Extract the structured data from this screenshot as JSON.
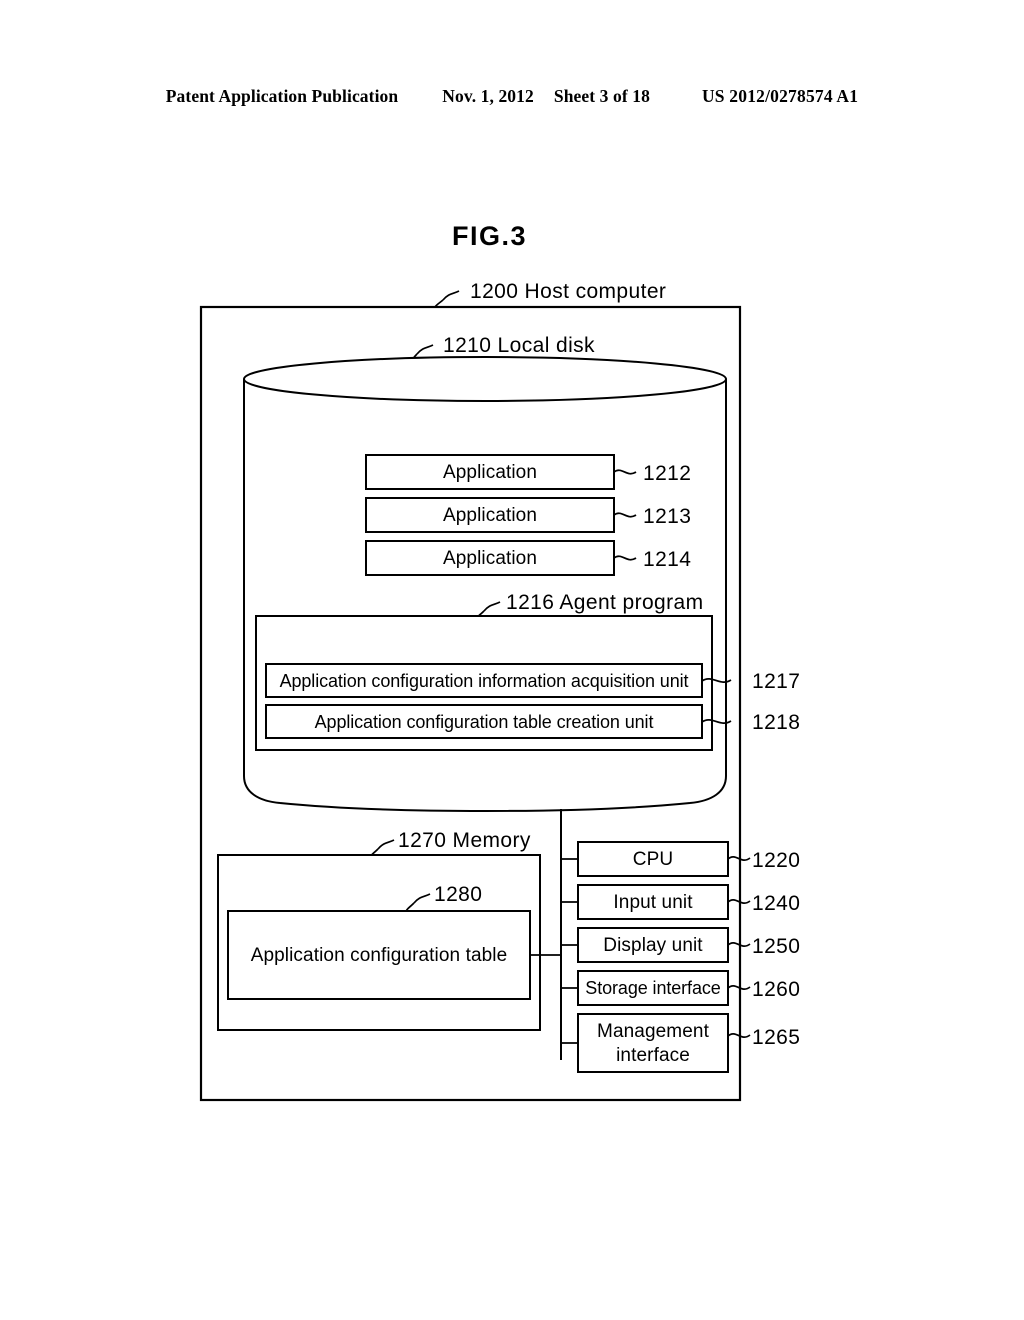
{
  "header": {
    "publication": "Patent Application Publication",
    "date": "Nov. 1, 2012",
    "sheet": "Sheet 3 of 18",
    "patent_number": "US 2012/0278574 A1"
  },
  "figure": {
    "title": "FIG.3",
    "host_computer": {
      "ref": "1200",
      "label": "1200 Host computer"
    },
    "local_disk": {
      "ref": "1210",
      "label": "1210 Local disk"
    },
    "applications": [
      {
        "label": "Application",
        "ref": "1212"
      },
      {
        "label": "Application",
        "ref": "1213"
      },
      {
        "label": "Application",
        "ref": "1214"
      }
    ],
    "agent_program": {
      "ref": "1216",
      "label": "1216 Agent program",
      "units": [
        {
          "label": "Application configuration information acquisition unit",
          "ref": "1217"
        },
        {
          "label": "Application configuration table creation unit",
          "ref": "1218"
        }
      ]
    },
    "memory": {
      "ref": "1270",
      "label": "1270 Memory",
      "table": {
        "ref": "1280",
        "label": "Application configuration table"
      }
    },
    "hardware": [
      {
        "label": "CPU",
        "ref": "1220"
      },
      {
        "label": "Input unit",
        "ref": "1240"
      },
      {
        "label": "Display unit",
        "ref": "1250"
      },
      {
        "label": "Storage interface",
        "ref": "1260"
      },
      {
        "label_line1": "Management",
        "label_line2": "interface",
        "ref": "1265"
      }
    ]
  }
}
